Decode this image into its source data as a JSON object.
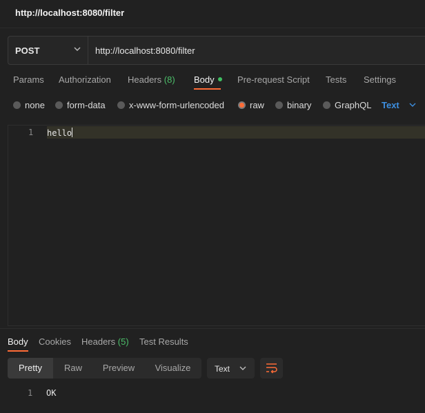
{
  "window": {
    "title": "http://localhost:8080/filter"
  },
  "request": {
    "method": "POST",
    "url": "http://localhost:8080/filter"
  },
  "tabs": [
    {
      "label": "Params"
    },
    {
      "label": "Authorization"
    },
    {
      "label": "Headers",
      "count": "(8)"
    },
    {
      "label": "Body"
    },
    {
      "label": "Pre-request Script"
    },
    {
      "label": "Tests"
    },
    {
      "label": "Settings"
    }
  ],
  "body_types": [
    {
      "label": "none",
      "selected": false
    },
    {
      "label": "form-data",
      "selected": false
    },
    {
      "label": "x-www-form-urlencoded",
      "selected": false
    },
    {
      "label": "raw",
      "selected": true
    },
    {
      "label": "binary",
      "selected": false
    },
    {
      "label": "GraphQL",
      "selected": false
    }
  ],
  "raw_format": "Text",
  "editor": {
    "lines": [
      {
        "num": "1",
        "text": "hello"
      }
    ]
  },
  "response": {
    "tabs": [
      {
        "label": "Body"
      },
      {
        "label": "Cookies"
      },
      {
        "label": "Headers",
        "count": "(5)"
      },
      {
        "label": "Test Results"
      }
    ],
    "view_modes": [
      "Pretty",
      "Raw",
      "Preview",
      "Visualize"
    ],
    "format": "Text",
    "lines": [
      {
        "num": "1",
        "text": "OK"
      }
    ]
  },
  "colors": {
    "accent": "#ff6c37",
    "link": "#3d8fe0",
    "count": "#4cbf6a"
  }
}
